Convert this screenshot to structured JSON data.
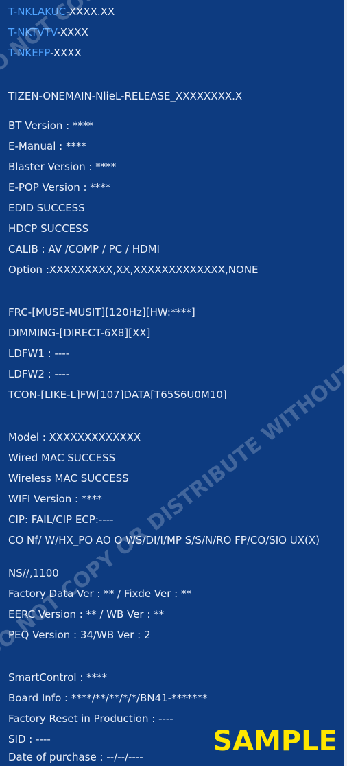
{
  "models": [
    {
      "prefix": "T-NKLAKUC",
      "suffix": "-XXXX.XX"
    },
    {
      "prefix": "T-NKTVTV",
      "suffix": "-XXXX"
    },
    {
      "prefix": "T-NKEFP",
      "suffix": "-XXXX"
    }
  ],
  "release": "TIZEN-ONEMAIN-NlieL-RELEASE_XXXXXXXX.X",
  "section1": [
    "BT Version : ****",
    "E-Manual : ****",
    "Blaster Version : ****",
    "E-POP Version : ****",
    "EDID SUCCESS",
    "HDCP SUCCESS",
    "CALIB : AV /COMP / PC / HDMI",
    "Option :XXXXXXXXX,XX,XXXXXXXXXXXXX,NONE"
  ],
  "section2": [
    "FRC-[MUSE-MUSIT][120Hz][HW:****]",
    "DIMMING-[DIRECT-6X8][XX]",
    "LDFW1 : ----",
    "LDFW2 : ----",
    "TCON-[LIKE-L]FW[107]DATA[T65S6U0M10]"
  ],
  "section3": [
    "Model : XXXXXXXXXXXXX",
    "Wired MAC SUCCESS",
    "Wireless MAC SUCCESS",
    "WIFI Version : ****",
    "CIP: FAIL/CIP ECP:----",
    "CO Nf/ W/HX_PO AO O WS/DI/I/MP S/S/N/RO FP/CO/SIO UX(X)",
    "NS//,1100",
    "Factory Data Ver : ** / Fixde Ver : **",
    "EERC Version : ** / WB Ver : **",
    "PEQ Version : 34/WB Ver : 2"
  ],
  "section4": [
    "SmartControl : ****",
    "Board Info : ****/**/**/*/*/BN41-*******",
    "Factory Reset in Production : ----",
    "SID : ----",
    "Date of purchase : --/--/----"
  ],
  "watermark": "DO NOT COPY OR DISTRIBUTE WITHOUT",
  "sample_label": "SAMPLE",
  "colors": {
    "background": "#0d3b80",
    "model_accent": "#4fa3ff",
    "sample": "#ffe600"
  }
}
